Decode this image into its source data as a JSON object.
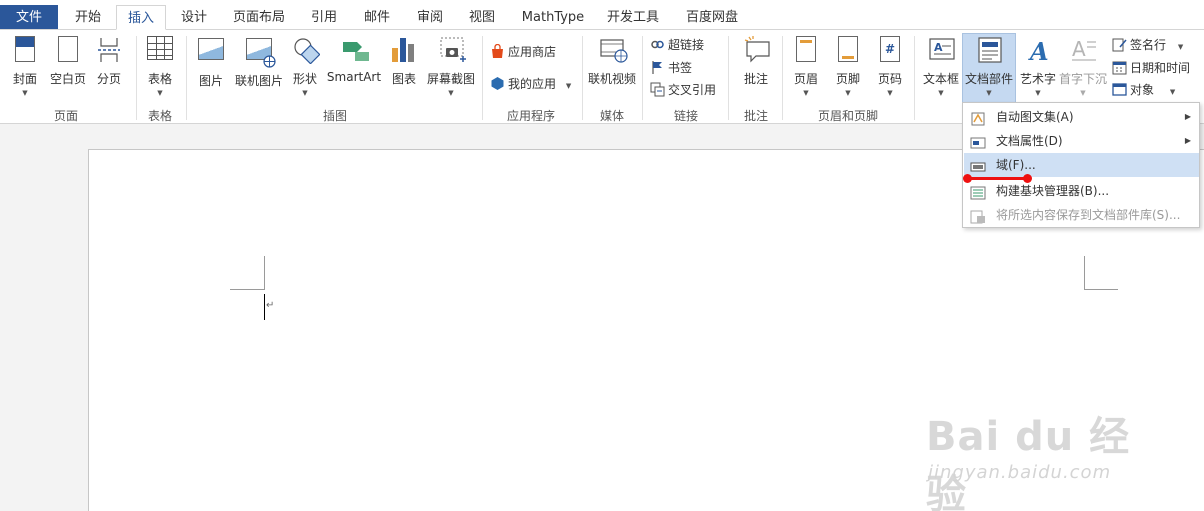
{
  "tabs": {
    "file": "文件",
    "items": [
      "开始",
      "插入",
      "设计",
      "页面布局",
      "引用",
      "邮件",
      "审阅",
      "视图",
      "MathType",
      "开发工具",
      "百度网盘"
    ],
    "active_index": 1
  },
  "ribbon": {
    "page": {
      "cover": "封面",
      "blank": "空白页",
      "break": "分页",
      "group": "页面"
    },
    "table": {
      "table": "表格",
      "group": "表格"
    },
    "illustrations": {
      "picture": "图片",
      "online_picture": "联机图片",
      "shapes": "形状",
      "smartart": "SmartArt",
      "chart": "图表",
      "screenshot": "屏幕截图",
      "group": "插图"
    },
    "apps": {
      "store": "应用商店",
      "my_apps": "我的应用",
      "group": "应用程序"
    },
    "media": {
      "online_video": "联机视频",
      "group": "媒体"
    },
    "links": {
      "hyperlink": "超链接",
      "bookmark": "书签",
      "cross_ref": "交叉引用",
      "group": "链接"
    },
    "comments": {
      "comment": "批注",
      "group": "批注"
    },
    "header_footer": {
      "header": "页眉",
      "footer": "页脚",
      "page_number": "页码",
      "group": "页眉和页脚"
    },
    "text": {
      "textbox": "文本框",
      "quick_parts": "文档部件",
      "wordart": "艺术字",
      "dropcap": "首字下沉",
      "signature": "签名行",
      "datetime": "日期和时间",
      "object": "对象"
    }
  },
  "menu": {
    "items": [
      {
        "label": "自动图文集(A)",
        "has_submenu": true,
        "disabled": false,
        "hover": false
      },
      {
        "label": "文档属性(D)",
        "has_submenu": true,
        "disabled": false,
        "hover": false
      },
      {
        "label": "域(F)...",
        "has_submenu": false,
        "disabled": false,
        "hover": true
      },
      {
        "label": "构建基块管理器(B)...",
        "has_submenu": false,
        "disabled": false,
        "hover": false
      },
      {
        "label": "将所选内容保存到文档部件库(S)...",
        "has_submenu": false,
        "disabled": true,
        "hover": false
      }
    ]
  },
  "watermark": {
    "text": "Bai du 经验",
    "url": "jingyan.baidu.com"
  },
  "colors": {
    "accent": "#2b579a",
    "hover": "#cfe0f4",
    "annotation": "#ee1111"
  }
}
